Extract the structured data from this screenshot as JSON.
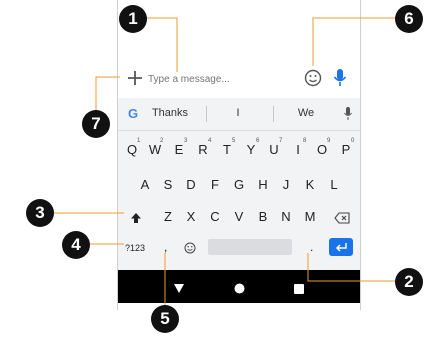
{
  "compose": {
    "placeholder": "Type a message..."
  },
  "suggestions": [
    "Thanks",
    "I",
    "We"
  ],
  "keyboard": {
    "row1": [
      "Q",
      "W",
      "E",
      "R",
      "T",
      "Y",
      "U",
      "I",
      "O",
      "P"
    ],
    "row1_hints": [
      "1",
      "2",
      "3",
      "4",
      "5",
      "6",
      "7",
      "8",
      "9",
      "0"
    ],
    "row2": [
      "A",
      "S",
      "D",
      "F",
      "G",
      "H",
      "J",
      "K",
      "L"
    ],
    "row3": [
      "Z",
      "X",
      "C",
      "V",
      "B",
      "N",
      "M"
    ],
    "symbols_label": "?123",
    "comma": ",",
    "period": "."
  },
  "callouts": [
    "1",
    "2",
    "3",
    "4",
    "5",
    "6",
    "7"
  ],
  "colors": {
    "accent": "#1a73e8",
    "badge": "#111111",
    "navbar": "#000000"
  },
  "icons": [
    "plus-icon",
    "emoji-icon",
    "mic-icon",
    "google-icon",
    "shift-icon",
    "backspace-icon",
    "enter-icon",
    "back-icon",
    "home-icon",
    "recents-icon"
  ]
}
